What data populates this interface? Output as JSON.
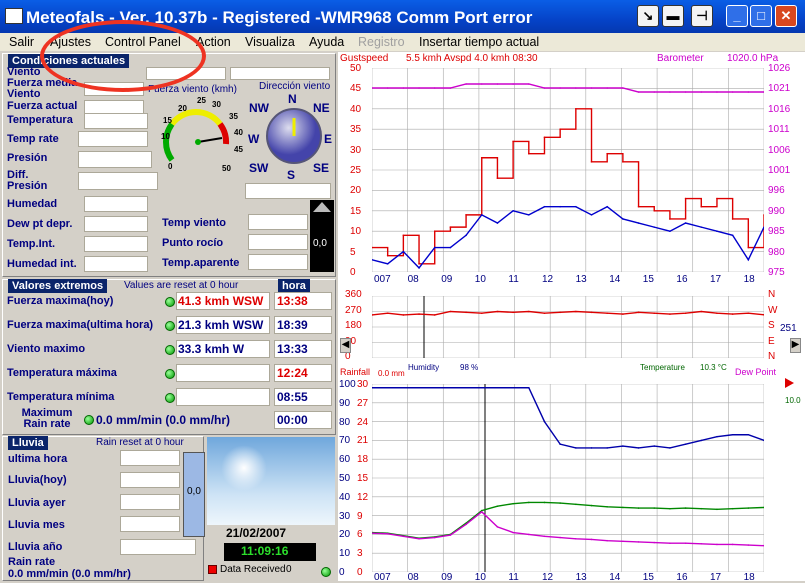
{
  "window": {
    "title": "Meteofals - Ver. 10.37b - Registered  -WMR968 Comm Port error"
  },
  "menu": [
    "Salir",
    "Ajustes",
    "Control Panel",
    "Action",
    "Visualiza",
    "Ayuda",
    "Registro",
    "Insertar tiempo actual"
  ],
  "current": {
    "header": "Condiciones actuales",
    "labels": [
      "Viento",
      "Fuerza media Viento",
      "Fuerza actual",
      "Temperatura",
      "Temp rate",
      "Presión",
      "Diff. Presión",
      "Humedad",
      "Dew pt depr.",
      "Temp.Int.",
      "Humedad int."
    ],
    "right_labels": [
      "Temp viento",
      "Punto rocío",
      "Temp.aparente"
    ],
    "gauge_speed_title": "Fuerza viento (kmh)",
    "gauge_dir_title": "Dirección viento",
    "compass": [
      "N",
      "NE",
      "E",
      "SE",
      "S",
      "SW",
      "W",
      "NW"
    ],
    "speed_ticks": [
      "0",
      "5",
      "10",
      "15",
      "20",
      "25",
      "30",
      "35",
      "40",
      "45",
      "50"
    ],
    "bar_val": "0,0"
  },
  "extremes": {
    "header": "Valores extremos",
    "note": "Values are reset at 0 hour",
    "hora": "hora",
    "rows": [
      {
        "label": "Fuerza maxima(hoy)",
        "value": "41.3 kmh WSW",
        "time": "13:38",
        "value_red": true,
        "time_red": true
      },
      {
        "label": "Fuerza maxima(ultima hora)",
        "value": "21.3 kmh WSW",
        "time": "18:39",
        "value_red": false,
        "time_red": false
      },
      {
        "label": "Viento maximo",
        "value": "33.3 kmh W",
        "time": "13:33",
        "value_red": false,
        "time_red": false
      },
      {
        "label": "Temperatura máxima",
        "value": "",
        "time": "12:24",
        "value_red": false,
        "time_red": true
      },
      {
        "label": "Temperatura mínima",
        "value": "",
        "time": "08:55",
        "value_red": false,
        "time_red": false
      },
      {
        "label": "Maximum Rain rate",
        "value": "0.0 mm/min (0.0 mm/hr)",
        "time": "00:00",
        "value_red": false,
        "time_red": false
      }
    ]
  },
  "rain": {
    "header": "Lluvia",
    "note": "Rain reset at 0 hour",
    "labels": [
      "ultima hora",
      "Lluvia(hoy)",
      "Lluvia ayer",
      "Lluvia mes",
      "Lluvia año",
      "Rain rate"
    ],
    "rate_value": "0.0 mm/min (0.0 mm/hr)",
    "bar_val": "0,0"
  },
  "sky": {
    "date": "21/02/2007",
    "time": "11:09:16",
    "data_received": "Data Received",
    "dr_count": "0"
  },
  "chart1": {
    "header_left": "Gustspeed",
    "header_mid": "5.5 kmh Avspd    4.0 kmh 08:30",
    "header_right": "Barometer",
    "header_val": "1020.0 hPa",
    "yleft": [
      "50",
      "45",
      "40",
      "35",
      "30",
      "25",
      "20",
      "15",
      "10",
      "5",
      "0"
    ],
    "yright": [
      "1026",
      "1021",
      "1016",
      "1011",
      "1006",
      "1001",
      "996",
      "990",
      "985",
      "980",
      "975"
    ],
    "xticks": [
      "007",
      "08",
      "09",
      "10",
      "11",
      "12",
      "13",
      "14",
      "15",
      "16",
      "17",
      "18"
    ]
  },
  "chart2": {
    "yleft": [
      "360",
      "270",
      "180",
      "90",
      "0"
    ],
    "yright": [
      "N",
      "W",
      "S",
      "E",
      "N"
    ],
    "side_val": "251"
  },
  "chart3": {
    "rainfall": "Rainfall",
    "rain_val": "0.0 mm",
    "humidity": "Humidity",
    "hum_val": "98 %",
    "temperature": "Temperature",
    "temp_val": "10.3 °C",
    "dewpoint": "Dew Point",
    "dew_val": "10.0",
    "yleft1": [
      "100",
      "90",
      "80",
      "70",
      "60",
      "50",
      "40",
      "30",
      "20",
      "10",
      "0"
    ],
    "yleft2": [
      "30",
      "27",
      "24",
      "21",
      "18",
      "15",
      "12",
      "9",
      "6",
      "3",
      "0"
    ],
    "yright_val": "10.0"
  },
  "chart_data": [
    {
      "type": "line",
      "title": "",
      "series": [
        {
          "name": "Gustspeed",
          "values": [
            6,
            4,
            9,
            2,
            10,
            11,
            14,
            28,
            23,
            32,
            29,
            33,
            35,
            40,
            27,
            29,
            27,
            16,
            15,
            13,
            18,
            16,
            18,
            13,
            6,
            14
          ]
        },
        {
          "name": "Avspd",
          "values": [
            3,
            2,
            5,
            1,
            6,
            6,
            9,
            14,
            12,
            15,
            14,
            16,
            16,
            16,
            14,
            16,
            13,
            12,
            11,
            10,
            12,
            11,
            10,
            9,
            3,
            11
          ]
        },
        {
          "name": "Barometer",
          "values": [
            1021,
            1021,
            1021,
            1021,
            1021,
            1021,
            1022,
            1022,
            1022,
            1022,
            1022,
            1021,
            1021,
            1021,
            1021,
            1021,
            1021,
            1020,
            1020,
            1020,
            1020,
            1020,
            1020,
            1020,
            1020,
            1020
          ]
        }
      ],
      "ylim": [
        0,
        50
      ],
      "y2lim": [
        975,
        1026
      ]
    },
    {
      "type": "line",
      "series": [
        {
          "name": "Direction",
          "values": [
            250,
            260,
            250,
            255,
            250,
            270,
            265,
            260,
            270,
            265,
            270,
            260,
            265,
            270,
            265,
            260,
            255,
            265,
            260,
            255,
            260,
            270,
            260,
            255,
            260,
            251
          ]
        }
      ],
      "ylim": [
        0,
        360
      ]
    },
    {
      "type": "line",
      "series": [
        {
          "name": "Humidity",
          "values": [
            98,
            98,
            98,
            98,
            98,
            98,
            98,
            98,
            98,
            98,
            98,
            80,
            68,
            66,
            66,
            66,
            67,
            66,
            67,
            66,
            68,
            70,
            72,
            73,
            73,
            70
          ]
        },
        {
          "name": "Temperature",
          "values": [
            6.3,
            6.2,
            5.8,
            5.4,
            5.6,
            6.0,
            7.8,
            9.8,
            10.5,
            10.9,
            11.1,
            11.1,
            11.0,
            10.8,
            10.6,
            10.4,
            10.3,
            10.2,
            10.2,
            10.1,
            10.2,
            10.1,
            10.0,
            10.1,
            10.2,
            10.3
          ]
        },
        {
          "name": "Dew Point",
          "values": [
            6.2,
            6.1,
            5.7,
            5.3,
            5.5,
            5.9,
            7.6,
            9.6,
            7.2,
            6.3,
            6.0,
            5.7,
            5.5,
            5.3,
            5.2,
            5.0,
            4.9,
            4.8,
            4.7,
            4.6,
            4.6,
            4.5,
            4.4,
            4.4,
            4.3,
            4.2
          ]
        }
      ],
      "ylim": [
        0,
        30
      ]
    }
  ]
}
